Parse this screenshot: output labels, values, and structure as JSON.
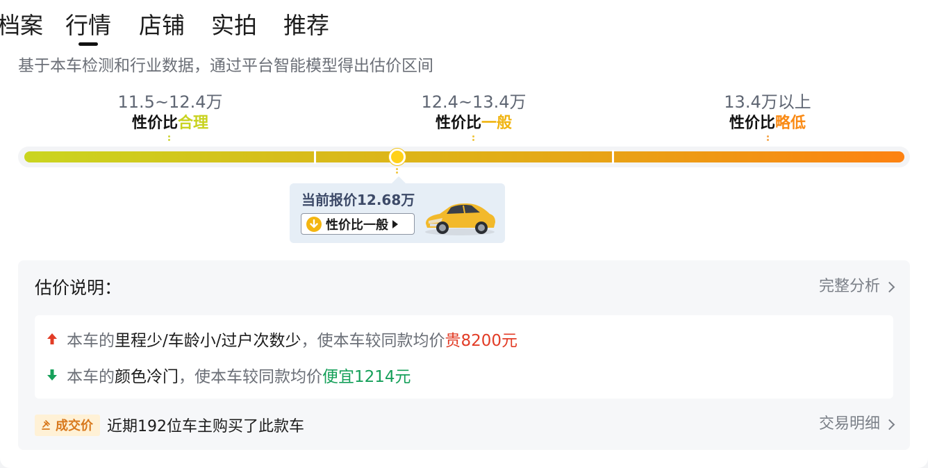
{
  "tabs": [
    {
      "label": "档案"
    },
    {
      "label": "行情",
      "active": true
    },
    {
      "label": "店铺"
    },
    {
      "label": "实拍"
    },
    {
      "label": "推荐"
    }
  ],
  "subtitle": "基于本车检测和行业数据，通过平台智能模型得出估价区间",
  "ranges": [
    {
      "price": "11.5~12.4万",
      "label_prefix": "性价比",
      "label_level": "合理",
      "level_color": "#c8d21e"
    },
    {
      "price": "12.4~13.4万",
      "label_prefix": "性价比",
      "label_level": "一般",
      "level_color": "#f0b411"
    },
    {
      "price": "13.4万以上",
      "label_prefix": "性价比",
      "label_level": "略低",
      "level_color": "#fa8a14"
    }
  ],
  "current": {
    "price_text": "当前报价12.68万",
    "verdict": "性价比一般",
    "car_icon": "yellow-sedan-image"
  },
  "explanation": {
    "title": "估价说明：",
    "link": "完整分析",
    "factors": [
      {
        "direction": "up",
        "pre": "本车的",
        "reason": "里程少/车龄小/过户次数少",
        "mid": "，使本车较同款均价",
        "effect": "贵8200元"
      },
      {
        "direction": "down",
        "pre": "本车的",
        "reason": "颜色冷门",
        "mid": "，使本车较同款均价",
        "effect": "便宜1214元"
      }
    ],
    "deal_badge": "成交价",
    "deal_text": "近期192位车主购买了此款车",
    "deal_link": "交易明细"
  },
  "colors": {
    "bar_start": "#cad520",
    "bar_end": "#fd8212",
    "marker": "#ffd118",
    "up": "#e23c26",
    "down": "#16a05a"
  }
}
